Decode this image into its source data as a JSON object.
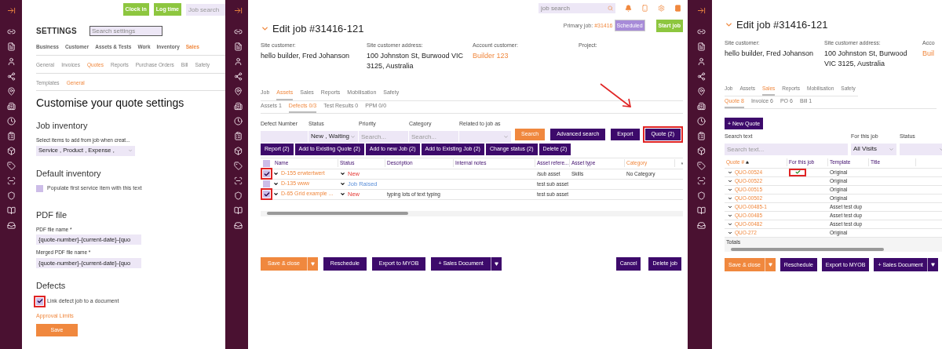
{
  "settings": {
    "top_buttons": [
      "Clock in",
      "Log time"
    ],
    "job_search": {
      "placeholder": "Job search"
    },
    "title": "SETTINGS",
    "search": {
      "placeholder": "Search settings"
    },
    "tabs": [
      {
        "label": "Business",
        "selected": false
      },
      {
        "label": "Customer",
        "selected": false
      },
      {
        "label": "Assets & Tests",
        "selected": false
      },
      {
        "label": "Work",
        "selected": false
      },
      {
        "label": "Inventory",
        "selected": false
      },
      {
        "label": "Sales",
        "selected": true
      }
    ],
    "subtabs": [
      {
        "label": "General",
        "selected": false
      },
      {
        "label": "Invoices",
        "selected": false
      },
      {
        "label": "Quotes",
        "selected": true
      },
      {
        "label": "Reports",
        "selected": false
      },
      {
        "label": "Purchase Orders",
        "selected": false
      },
      {
        "label": "Bill",
        "selected": false
      },
      {
        "label": "Safety",
        "selected": false
      }
    ],
    "subsubtabs": [
      {
        "label": "Templates",
        "selected": false
      },
      {
        "label": "General",
        "selected": true
      }
    ],
    "heading": "Customise your quote settings",
    "job_inventory": {
      "title": "Job inventory",
      "label": "Select items to add from job when creat...",
      "value": "Service , Product , Expense ,"
    },
    "default_inventory": {
      "title": "Default inventory",
      "checkbox": {
        "label": "Populate first service item with this text",
        "checked": false,
        "highlighted": false
      }
    },
    "pdf_file": {
      "title": "PDF file",
      "fields": [
        {
          "label": "PDF file name *",
          "value": "{quote-number}-{current-date}-{quo"
        },
        {
          "label": "Merged PDF file name *",
          "value": "{quote-number}-{current-date}-{quo"
        }
      ]
    },
    "defects": {
      "title": "Defects",
      "checkbox": {
        "label": "Link defect job to a document",
        "checked": true,
        "highlighted": true
      }
    },
    "approval_link": "Approval Limits",
    "save_button": "Save"
  },
  "job": {
    "search": {
      "placeholder": "job search"
    },
    "primary_job": {
      "label": "Primary job:",
      "number": "#31416",
      "status": "Scheduled"
    },
    "start_button": "Start job",
    "title": "Edit job #31416-121",
    "info": [
      {
        "label": "Site customer:",
        "value": "hello builder, Fred Johanson",
        "kind": "text"
      },
      {
        "label": "Site customer address:",
        "value": "100 Johnston St, Burwood VIC 3125, Australia",
        "kind": "text"
      },
      {
        "label": "Account customer:",
        "value": "Builder 123",
        "kind": "link"
      },
      {
        "label": "Project:"
      }
    ],
    "tabs": [
      {
        "label": "Job",
        "selected": false
      },
      {
        "label": "Assets",
        "selected": true
      },
      {
        "label": "Sales",
        "selected": false
      },
      {
        "label": "Reports",
        "selected": false
      },
      {
        "label": "Mobilisation",
        "selected": false
      },
      {
        "label": "Safety",
        "selected": false
      }
    ],
    "subtabs": [
      {
        "label": "Assets 1",
        "selected": false
      },
      {
        "label": "Defects 0/3",
        "selected": true
      },
      {
        "label": "Test Results 0",
        "selected": false
      },
      {
        "label": "PPM 0/0",
        "selected": false
      }
    ],
    "filters": [
      {
        "label": "Defect Number",
        "kind": "text"
      },
      {
        "label": "Status",
        "kind": "select",
        "value": "New , Waiting"
      },
      {
        "label": "Priority",
        "kind": "text",
        "placeholder": "Search..."
      },
      {
        "label": "Category",
        "kind": "text",
        "placeholder": "Search..."
      },
      {
        "label": "Related to job as",
        "kind": "select"
      }
    ],
    "filter_buttons": [
      {
        "label": "Search",
        "kind": "primary",
        "highlighted": false
      },
      {
        "label": "Advanced search",
        "kind": "secondary",
        "highlighted": false
      },
      {
        "label": "Export",
        "kind": "secondary",
        "highlighted": false
      },
      {
        "label": "Quote (2)",
        "kind": "secondary",
        "highlighted": true
      }
    ],
    "actions": [
      "Report (2)",
      "Add to Existing Quote (2)",
      "Add to new Job (2)",
      "Add to Existing Job (2)",
      "Change status (2)",
      "Delete (2)"
    ],
    "select_all": {
      "checked": false
    },
    "columns": [
      {
        "label": "Name",
        "sorted": false
      },
      {
        "label": "Status",
        "sorted": false
      },
      {
        "label": "Description",
        "sorted": false
      },
      {
        "label": "Internal notes",
        "sorted": false
      },
      {
        "label": "Asset refere...",
        "sorted": false
      },
      {
        "label": "Asset type",
        "sorted": false
      },
      {
        "label": "Category",
        "sorted": true
      }
    ],
    "rows": [
      {
        "checked": true,
        "highlighted": true,
        "name": "D-155 erwtertwert",
        "status": "New",
        "kind": "new",
        "description": "",
        "asset_reference": "/sub asset",
        "asset_type": "Skills",
        "category": "No Category"
      },
      {
        "checked": false,
        "highlighted": false,
        "name": "D-135 www",
        "status": "Job Raised",
        "kind": "raised",
        "description": "",
        "asset_reference": "test sub asset",
        "asset_type": "",
        "category": ""
      },
      {
        "checked": true,
        "highlighted": true,
        "name": "D-65 Grid example ...",
        "status": "New",
        "kind": "new",
        "description": "typing lots of text typing",
        "asset_reference": "test sub asset",
        "asset_type": "",
        "category": ""
      }
    ],
    "footer_left": [
      {
        "label": "Save & close",
        "kind": "primary",
        "caret": true
      },
      {
        "label": "Reschedule",
        "kind": "secondary",
        "caret": false
      },
      {
        "label": "Export to MYOB",
        "kind": "secondary",
        "caret": false
      },
      {
        "label": "+ Sales Document",
        "kind": "secondary",
        "caret": true
      }
    ],
    "footer_right": [
      "Cancel",
      "Delete job"
    ]
  },
  "quotes": {
    "title": "Edit job #31416-121",
    "info": [
      {
        "label": "Site customer:",
        "value": "hello builder, Fred Johanson",
        "kind": "text"
      },
      {
        "label": "Site customer address:",
        "value": "100 Johnston St, Burwood VIC 3125, Australia",
        "kind": "text"
      },
      {
        "label": "Acco",
        "value": "Buil",
        "kind": "link"
      }
    ],
    "tabs": [
      {
        "label": "Job",
        "selected": false
      },
      {
        "label": "Assets",
        "selected": false
      },
      {
        "label": "Sales",
        "selected": true
      },
      {
        "label": "Reports",
        "selected": false
      },
      {
        "label": "Mobilisation",
        "selected": false
      },
      {
        "label": "Safety",
        "selected": false
      }
    ],
    "subtabs": [
      {
        "label": "Quote 8",
        "selected": true
      },
      {
        "label": "Invoice 6",
        "selected": false
      },
      {
        "label": "PO 6",
        "selected": false
      },
      {
        "label": "Bill 1",
        "selected": false
      }
    ],
    "new_button": "+ New Quote",
    "filters": [
      {
        "label": "Search text",
        "kind": "text",
        "placeholder": "Search text..."
      },
      {
        "label": "For this job",
        "kind": "select",
        "value": "All Visits"
      },
      {
        "label": "Status",
        "kind": "select"
      }
    ],
    "columns": [
      {
        "label": "Quote #",
        "sorted": true
      },
      {
        "label": "For this job",
        "sorted": false
      },
      {
        "label": "Template",
        "sorted": false
      },
      {
        "label": "Title",
        "sorted": false
      }
    ],
    "rows": [
      {
        "number": "QUO-00524",
        "for_this_job": true,
        "highlighted": true,
        "template": "Original"
      },
      {
        "number": "QUO-00522",
        "for_this_job": false,
        "highlighted": false,
        "template": "Original"
      },
      {
        "number": "QUO-00515",
        "for_this_job": false,
        "highlighted": false,
        "template": "Original"
      },
      {
        "number": "QUO-00502",
        "for_this_job": false,
        "highlighted": false,
        "template": "Original"
      },
      {
        "number": "QUO-00485-1",
        "for_this_job": false,
        "highlighted": false,
        "template": "Asset test dup"
      },
      {
        "number": "QUO-00485",
        "for_this_job": false,
        "highlighted": false,
        "template": "Asset test dup"
      },
      {
        "number": "QUO-00482",
        "for_this_job": false,
        "highlighted": false,
        "template": "Asset test dup"
      },
      {
        "number": "QUO-272",
        "for_this_job": false,
        "highlighted": false,
        "template": "Original"
      }
    ],
    "totals": "Totals",
    "footer_left": [
      {
        "label": "Save & close",
        "kind": "primary",
        "caret": true
      },
      {
        "label": "Reschedule",
        "kind": "secondary",
        "caret": false
      },
      {
        "label": "Export to MYOB",
        "kind": "secondary",
        "caret": false
      },
      {
        "label": "+ Sales Document",
        "kind": "secondary",
        "caret": true
      }
    ]
  }
}
